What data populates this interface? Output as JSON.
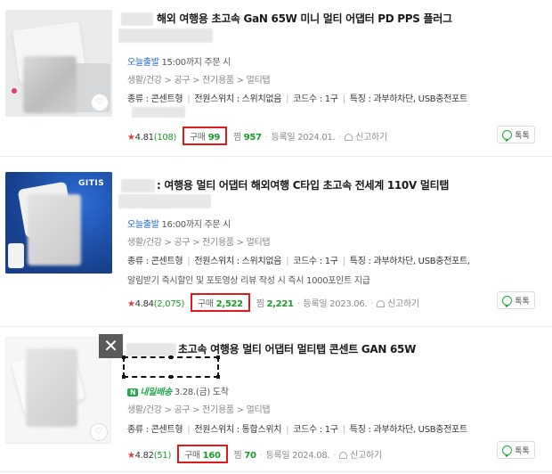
{
  "products": [
    {
      "title": "해외 여행용 초고속 GaN 65W 미니 멀티 어댑터 PD PPS 플러그",
      "delivery_badge": "오늘출발",
      "delivery_time": "15:00까지 주문 시",
      "category": "생활/건강 > 공구 > 전기용품 > 멀티탭",
      "specs": "종류 : 콘센트형",
      "spec2": "전원스위치 : 스위치없음",
      "spec3": "코드수 : 1구",
      "spec4": "특징 : 과부하차단, USB충전포트",
      "rating": "4.81",
      "reviews": "(108)",
      "buy_label": "구매",
      "buy_count": "99",
      "zzim_label": "찜",
      "zzim_count": "957",
      "reg_date": "등록일 2024.01.",
      "report": "신고하기",
      "talk": "톡톡"
    },
    {
      "title": ": 여행용 멀티 어댑터 해외여행 C타입 초고속 전세계 110V 멀티탭",
      "brand_on_image": "GITIS",
      "delivery_badge": "오늘출발",
      "delivery_time": "16:00까지 주문 시",
      "category": "생활/건강 > 공구 > 전기용품 > 멀티탭",
      "specs": "종류 : 콘센트형",
      "spec2": "전원스위치 : 스위치없음",
      "spec3": "코드수 : 1구",
      "spec4": "특징 : 과부하차단, USB충전포트,",
      "extra": "알림받기 즉시할인 및 포토영상 리뷰 작성 시 즉시 1000포인트 지급",
      "rating": "4.84",
      "reviews": "(2,075)",
      "buy_label": "구매",
      "buy_count": "2,522",
      "zzim_label": "찜",
      "zzim_count": "2,221",
      "reg_date": "등록일 2023.06.",
      "report": "신고하기",
      "talk": "톡톡"
    },
    {
      "title": "초고속 여행용 멀티 어댑터 멀티탭 콘센트 GAN 65W",
      "delivery_badge": "N",
      "delivery_text": "내일배송",
      "delivery_time": "3.28.(금) 도착",
      "category": "생활/건강 > 공구 > 전기용품 > 멀티탭",
      "specs": "종류 : 콘센트형",
      "spec2": "전원스위치 : 통합스위치",
      "spec3": "코드수 : 1구",
      "spec4": "특징 : 과부하차단, USB충전포트",
      "rating": "4.82",
      "reviews": "(51)",
      "buy_label": "구매",
      "buy_count": "160",
      "zzim_label": "찜",
      "zzim_count": "70",
      "reg_date": "등록일 2024.08.",
      "report": "신고하기",
      "talk": "톡톡",
      "close_symbol": "✕"
    }
  ],
  "colors": {
    "highlight_box": "#e0191b",
    "green": "#1a9c2b",
    "blue_badge": "#1b65d6"
  }
}
